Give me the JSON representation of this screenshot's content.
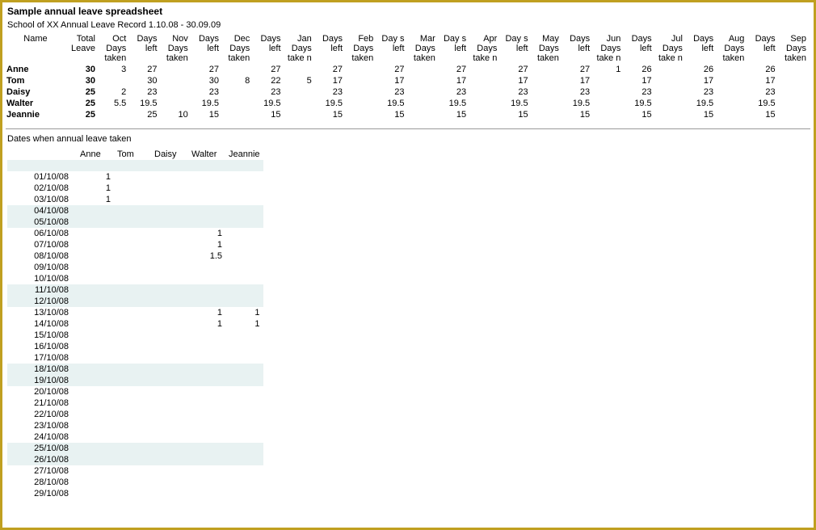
{
  "title": "Sample annual leave spreadsheet",
  "subtitle": "School of XX  Annual Leave Record 1.10.08 - 30.09.09",
  "summary": {
    "headers": [
      "Name",
      "Total Leave",
      "Oct Days taken",
      "Days left",
      "Nov Days taken",
      "Days left",
      "Dec Days taken",
      "Days left",
      "Jan Days take n",
      "Days left",
      "Feb Days taken",
      "Day s left",
      "Mar Days taken",
      "Day s left",
      "Apr Days take n",
      "Day s left",
      "May Days taken",
      "Days left",
      "Jun Days take n",
      "Days left",
      "Jul Days take n",
      "Days left",
      "Aug Days taken",
      "Days left",
      "Sep Days taken"
    ],
    "rows": [
      {
        "name": "Anne",
        "total": "30",
        "cells": [
          "3",
          "27",
          "",
          "27",
          "",
          "27",
          "",
          "27",
          "",
          "27",
          "",
          "27",
          "",
          "27",
          "",
          "27",
          "1",
          "26",
          "",
          "26",
          "",
          "26",
          "",
          ""
        ]
      },
      {
        "name": "Tom",
        "total": "30",
        "cells": [
          "",
          "30",
          "",
          "30",
          "8",
          "22",
          "5",
          "17",
          "",
          "17",
          "",
          "17",
          "",
          "17",
          "",
          "17",
          "",
          "17",
          "",
          "17",
          "",
          "17",
          "",
          ""
        ]
      },
      {
        "name": "Daisy",
        "total": "25",
        "cells": [
          "2",
          "23",
          "",
          "23",
          "",
          "23",
          "",
          "23",
          "",
          "23",
          "",
          "23",
          "",
          "23",
          "",
          "23",
          "",
          "23",
          "",
          "23",
          "",
          "23",
          "",
          ""
        ]
      },
      {
        "name": "Walter",
        "total": "25",
        "cells": [
          "5.5",
          "19.5",
          "",
          "19.5",
          "",
          "19.5",
          "",
          "19.5",
          "",
          "19.5",
          "",
          "19.5",
          "",
          "19.5",
          "",
          "19.5",
          "",
          "19.5",
          "",
          "19.5",
          "",
          "19.5",
          "",
          ""
        ]
      },
      {
        "name": "Jeannie",
        "total": "25",
        "cells": [
          "",
          "25",
          "10",
          "15",
          "",
          "15",
          "",
          "15",
          "",
          "15",
          "",
          "15",
          "",
          "15",
          "",
          "15",
          "",
          "15",
          "",
          "15",
          "",
          "15",
          "",
          ""
        ]
      }
    ]
  },
  "dates_title": "Dates when annual leave taken",
  "dates": {
    "people": [
      "Anne",
      "Tom",
      "Daisy",
      "Walter",
      "Jeannie"
    ],
    "rows": [
      {
        "date": "",
        "cells": [
          "",
          "",
          "",
          "",
          ""
        ],
        "band": true
      },
      {
        "date": "01/10/08",
        "cells": [
          "1",
          "",
          "",
          "",
          ""
        ],
        "band": false
      },
      {
        "date": "02/10/08",
        "cells": [
          "1",
          "",
          "",
          "",
          ""
        ],
        "band": false
      },
      {
        "date": "03/10/08",
        "cells": [
          "1",
          "",
          "",
          "",
          ""
        ],
        "band": false
      },
      {
        "date": "04/10/08",
        "cells": [
          "",
          "",
          "",
          "",
          ""
        ],
        "band": true
      },
      {
        "date": "05/10/08",
        "cells": [
          "",
          "",
          "",
          "",
          ""
        ],
        "band": true
      },
      {
        "date": "06/10/08",
        "cells": [
          "",
          "",
          "",
          "1",
          ""
        ],
        "band": false
      },
      {
        "date": "07/10/08",
        "cells": [
          "",
          "",
          "",
          "1",
          ""
        ],
        "band": false
      },
      {
        "date": "08/10/08",
        "cells": [
          "",
          "",
          "",
          "1.5",
          ""
        ],
        "band": false
      },
      {
        "date": "09/10/08",
        "cells": [
          "",
          "",
          "",
          "",
          ""
        ],
        "band": false
      },
      {
        "date": "10/10/08",
        "cells": [
          "",
          "",
          "",
          "",
          ""
        ],
        "band": false
      },
      {
        "date": "11/10/08",
        "cells": [
          "",
          "",
          "",
          "",
          ""
        ],
        "band": true
      },
      {
        "date": "12/10/08",
        "cells": [
          "",
          "",
          "",
          "",
          ""
        ],
        "band": true
      },
      {
        "date": "13/10/08",
        "cells": [
          "",
          "",
          "",
          "1",
          "1"
        ],
        "band": false
      },
      {
        "date": "14/10/08",
        "cells": [
          "",
          "",
          "",
          "1",
          "1"
        ],
        "band": false
      },
      {
        "date": "15/10/08",
        "cells": [
          "",
          "",
          "",
          "",
          ""
        ],
        "band": false
      },
      {
        "date": "16/10/08",
        "cells": [
          "",
          "",
          "",
          "",
          ""
        ],
        "band": false
      },
      {
        "date": "17/10/08",
        "cells": [
          "",
          "",
          "",
          "",
          ""
        ],
        "band": false
      },
      {
        "date": "18/10/08",
        "cells": [
          "",
          "",
          "",
          "",
          ""
        ],
        "band": true
      },
      {
        "date": "19/10/08",
        "cells": [
          "",
          "",
          "",
          "",
          ""
        ],
        "band": true
      },
      {
        "date": "20/10/08",
        "cells": [
          "",
          "",
          "",
          "",
          ""
        ],
        "band": false
      },
      {
        "date": "21/10/08",
        "cells": [
          "",
          "",
          "",
          "",
          ""
        ],
        "band": false
      },
      {
        "date": "22/10/08",
        "cells": [
          "",
          "",
          "",
          "",
          ""
        ],
        "band": false
      },
      {
        "date": "23/10/08",
        "cells": [
          "",
          "",
          "",
          "",
          ""
        ],
        "band": false
      },
      {
        "date": "24/10/08",
        "cells": [
          "",
          "",
          "",
          "",
          ""
        ],
        "band": false
      },
      {
        "date": "25/10/08",
        "cells": [
          "",
          "",
          "",
          "",
          ""
        ],
        "band": true
      },
      {
        "date": "26/10/08",
        "cells": [
          "",
          "",
          "",
          "",
          ""
        ],
        "band": true
      },
      {
        "date": "27/10/08",
        "cells": [
          "",
          "",
          "",
          "",
          ""
        ],
        "band": false
      },
      {
        "date": "28/10/08",
        "cells": [
          "",
          "",
          "",
          "",
          ""
        ],
        "band": false
      },
      {
        "date": "29/10/08",
        "cells": [
          "",
          "",
          "",
          "",
          ""
        ],
        "band": false
      }
    ]
  }
}
